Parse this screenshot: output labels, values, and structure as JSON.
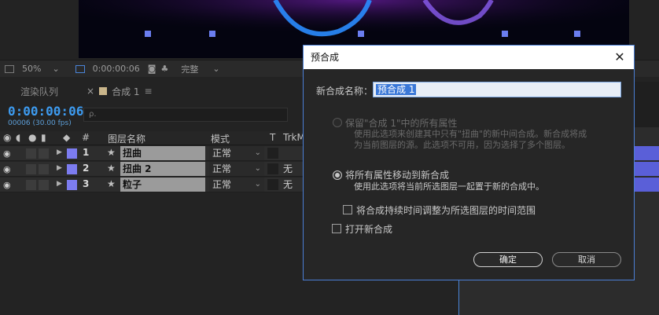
{
  "viewer": {
    "zoom": "50%",
    "timecode": "0:00:00:06",
    "quality": "完整"
  },
  "panels": {
    "render_queue_tab": "渲染队列",
    "comp_tab": "合成 1",
    "close_glyph": "×",
    "menu_glyph": "≡"
  },
  "timeline": {
    "timecode": "0:00:00:06",
    "frame_info": "00006 (30.00 fps)",
    "search_placeholder": "ρ.",
    "headers": {
      "num": "#",
      "layer_name": "图层名称",
      "mode": "模式",
      "t": "T",
      "trkmat": "TrkM"
    },
    "layers": [
      {
        "num": "1",
        "name": "扭曲",
        "mode": "正常",
        "trkmat": ""
      },
      {
        "num": "2",
        "name": "扭曲 2",
        "mode": "正常",
        "trkmat": "无"
      },
      {
        "num": "3",
        "name": "粒子",
        "mode": "正常",
        "trkmat": "无"
      }
    ]
  },
  "dialog": {
    "title": "预合成",
    "name_label": "新合成名称：",
    "name_value": "预合成 1",
    "option1": {
      "title": "保留\"合成 1\"中的所有属性",
      "desc_line1": "使用此选项来创建其中只有\"扭曲\"的新中间合成。新合成将成",
      "desc_line2": "为当前图层的源。此选项不可用，因为选择了多个图层。"
    },
    "option2": {
      "title": "将所有属性移动到新合成",
      "desc": "使用此选项将当前所选图层一起置于新的合成中。"
    },
    "checkbox_adjust": "将合成持续时间调整为所选图层的时间范围",
    "checkbox_open": "打开新合成",
    "ok": "确定",
    "cancel": "取消"
  },
  "colors": {
    "accent_blue": "#3d9bf0",
    "label_purple": "#7c7cf0",
    "dialog_border": "#4b7fd6"
  }
}
